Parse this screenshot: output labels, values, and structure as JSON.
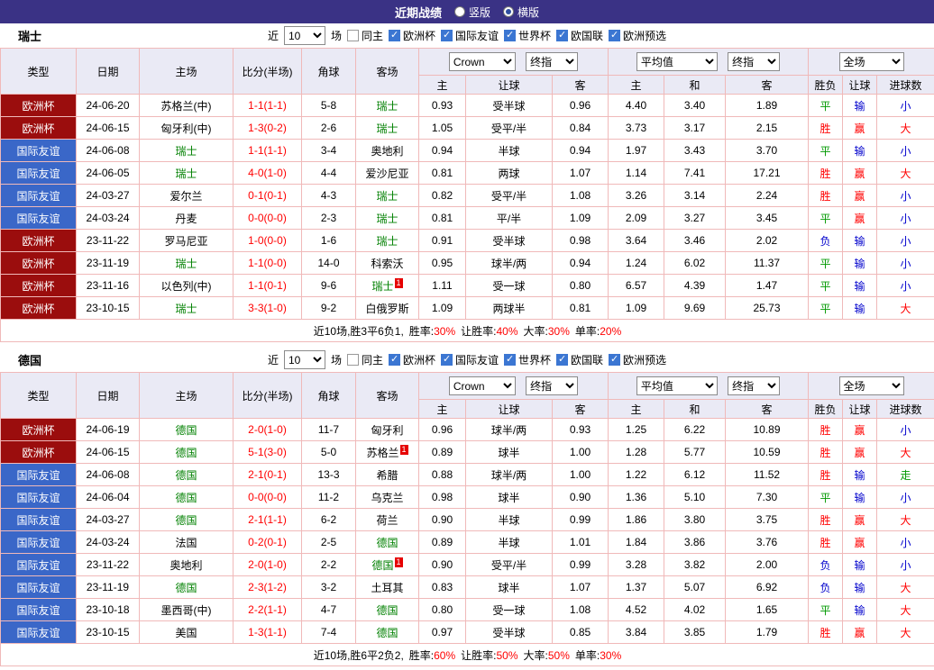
{
  "colors": {
    "topbar_bg": "#3A3285",
    "header_bg": "#EAEAF5",
    "border": "#F0B9B9",
    "cup_bg": "#9B0D0D",
    "friendly_bg": "#3A67C8",
    "focus": "#008000",
    "score": "#FF0000",
    "red": "#FF0000",
    "green": "#009900",
    "blue": "#0000CC"
  },
  "result_color_map": {
    "胜": "r",
    "平": "g",
    "负": "b",
    "赢": "r",
    "输": "b",
    "大": "r",
    "小": "b",
    "走": "g"
  },
  "topbar": {
    "title": "近期战绩",
    "radios": [
      {
        "label": "竖版",
        "selected": false
      },
      {
        "label": "横版",
        "selected": true
      }
    ]
  },
  "sections": [
    {
      "team": "瑞士",
      "filter": {
        "near": "近",
        "count": "10",
        "unit": "场",
        "checkboxes": [
          {
            "label": "同主",
            "checked": false
          },
          {
            "label": "欧洲杯",
            "checked": true
          },
          {
            "label": "国际友谊",
            "checked": true
          },
          {
            "label": "世界杯",
            "checked": true
          },
          {
            "label": "欧国联",
            "checked": true
          },
          {
            "label": "欧洲预选",
            "checked": true
          }
        ]
      },
      "table": {
        "col_headers": [
          "类型",
          "日期",
          "主场",
          "比分(半场)",
          "角球",
          "客场"
        ],
        "odds_selects": [
          "Crown",
          "终指"
        ],
        "avg_selects": [
          "平均值",
          "终指"
        ],
        "scope_select": "全场",
        "sub_headers": [
          "主",
          "让球",
          "客",
          "主",
          "和",
          "客",
          "胜负",
          "让球",
          "进球数"
        ],
        "rows": [
          {
            "type": "欧洲杯",
            "style": "cup",
            "date": "24-06-20",
            "home": "苏格兰(中)",
            "home_focus": false,
            "home_card": "",
            "score": "1-1(1-1)",
            "corners": "5-8",
            "away": "瑞士",
            "away_focus": true,
            "away_card": "",
            "odds": [
              "0.93",
              "受半球",
              "0.96"
            ],
            "avg": [
              "4.40",
              "3.40",
              "1.89"
            ],
            "results": [
              "平",
              "输",
              "小"
            ]
          },
          {
            "type": "欧洲杯",
            "style": "cup",
            "date": "24-06-15",
            "home": "匈牙利(中)",
            "home_focus": false,
            "home_card": "",
            "score": "1-3(0-2)",
            "corners": "2-6",
            "away": "瑞士",
            "away_focus": true,
            "away_card": "",
            "odds": [
              "1.05",
              "受平/半",
              "0.84"
            ],
            "avg": [
              "3.73",
              "3.17",
              "2.15"
            ],
            "results": [
              "胜",
              "赢",
              "大"
            ]
          },
          {
            "type": "国际友谊",
            "style": "friendly",
            "date": "24-06-08",
            "home": "瑞士",
            "home_focus": true,
            "home_card": "",
            "score": "1-1(1-1)",
            "corners": "3-4",
            "away": "奥地利",
            "away_focus": false,
            "away_card": "",
            "odds": [
              "0.94",
              "半球",
              "0.94"
            ],
            "avg": [
              "1.97",
              "3.43",
              "3.70"
            ],
            "results": [
              "平",
              "输",
              "小"
            ]
          },
          {
            "type": "国际友谊",
            "style": "friendly",
            "date": "24-06-05",
            "home": "瑞士",
            "home_focus": true,
            "home_card": "",
            "score": "4-0(1-0)",
            "corners": "4-4",
            "away": "爱沙尼亚",
            "away_focus": false,
            "away_card": "",
            "odds": [
              "0.81",
              "两球",
              "1.07"
            ],
            "avg": [
              "1.14",
              "7.41",
              "17.21"
            ],
            "results": [
              "胜",
              "赢",
              "大"
            ]
          },
          {
            "type": "国际友谊",
            "style": "friendly",
            "date": "24-03-27",
            "home": "爱尔兰",
            "home_focus": false,
            "home_card": "",
            "score": "0-1(0-1)",
            "corners": "4-3",
            "away": "瑞士",
            "away_focus": true,
            "away_card": "",
            "odds": [
              "0.82",
              "受平/半",
              "1.08"
            ],
            "avg": [
              "3.26",
              "3.14",
              "2.24"
            ],
            "results": [
              "胜",
              "赢",
              "小"
            ]
          },
          {
            "type": "国际友谊",
            "style": "friendly",
            "date": "24-03-24",
            "home": "丹麦",
            "home_focus": false,
            "home_card": "",
            "score": "0-0(0-0)",
            "corners": "2-3",
            "away": "瑞士",
            "away_focus": true,
            "away_card": "",
            "odds": [
              "0.81",
              "平/半",
              "1.09"
            ],
            "avg": [
              "2.09",
              "3.27",
              "3.45"
            ],
            "results": [
              "平",
              "赢",
              "小"
            ]
          },
          {
            "type": "欧洲杯",
            "style": "cup",
            "date": "23-11-22",
            "home": "罗马尼亚",
            "home_focus": false,
            "home_card": "",
            "score": "1-0(0-0)",
            "corners": "1-6",
            "away": "瑞士",
            "away_focus": true,
            "away_card": "",
            "odds": [
              "0.91",
              "受半球",
              "0.98"
            ],
            "avg": [
              "3.64",
              "3.46",
              "2.02"
            ],
            "results": [
              "负",
              "输",
              "小"
            ]
          },
          {
            "type": "欧洲杯",
            "style": "cup",
            "date": "23-11-19",
            "home": "瑞士",
            "home_focus": true,
            "home_card": "",
            "score": "1-1(0-0)",
            "corners": "14-0",
            "away": "科索沃",
            "away_focus": false,
            "away_card": "",
            "odds": [
              "0.95",
              "球半/两",
              "0.94"
            ],
            "avg": [
              "1.24",
              "6.02",
              "11.37"
            ],
            "results": [
              "平",
              "输",
              "小"
            ]
          },
          {
            "type": "欧洲杯",
            "style": "cup",
            "date": "23-11-16",
            "home": "以色列(中)",
            "home_focus": false,
            "home_card": "",
            "score": "1-1(0-1)",
            "corners": "9-6",
            "away": "瑞士",
            "away_focus": true,
            "away_card": "1",
            "odds": [
              "1.11",
              "受一球",
              "0.80"
            ],
            "avg": [
              "6.57",
              "4.39",
              "1.47"
            ],
            "results": [
              "平",
              "输",
              "小"
            ]
          },
          {
            "type": "欧洲杯",
            "style": "cup",
            "date": "23-10-15",
            "home": "瑞士",
            "home_focus": true,
            "home_card": "",
            "score": "3-3(1-0)",
            "corners": "9-2",
            "away": "白俄罗斯",
            "away_focus": false,
            "away_card": "",
            "odds": [
              "1.09",
              "两球半",
              "0.81"
            ],
            "avg": [
              "1.09",
              "9.69",
              "25.73"
            ],
            "results": [
              "平",
              "输",
              "大"
            ]
          }
        ]
      },
      "summary": {
        "prefix": "近10场,胜3平6负1,",
        "stats": [
          {
            "label": "胜率:",
            "value": "30%"
          },
          {
            "label": "让胜率:",
            "value": "40%"
          },
          {
            "label": "大率:",
            "value": "30%"
          },
          {
            "label": "单率:",
            "value": "20%"
          }
        ]
      }
    },
    {
      "team": "德国",
      "filter": {
        "near": "近",
        "count": "10",
        "unit": "场",
        "checkboxes": [
          {
            "label": "同主",
            "checked": false
          },
          {
            "label": "欧洲杯",
            "checked": true
          },
          {
            "label": "国际友谊",
            "checked": true
          },
          {
            "label": "世界杯",
            "checked": true
          },
          {
            "label": "欧国联",
            "checked": true
          },
          {
            "label": "欧洲预选",
            "checked": true
          }
        ]
      },
      "table": {
        "col_headers": [
          "类型",
          "日期",
          "主场",
          "比分(半场)",
          "角球",
          "客场"
        ],
        "odds_selects": [
          "Crown",
          "终指"
        ],
        "avg_selects": [
          "平均值",
          "终指"
        ],
        "scope_select": "全场",
        "sub_headers": [
          "主",
          "让球",
          "客",
          "主",
          "和",
          "客",
          "胜负",
          "让球",
          "进球数"
        ],
        "rows": [
          {
            "type": "欧洲杯",
            "style": "cup",
            "date": "24-06-19",
            "home": "德国",
            "home_focus": true,
            "home_card": "",
            "score": "2-0(1-0)",
            "corners": "11-7",
            "away": "匈牙利",
            "away_focus": false,
            "away_card": "",
            "odds": [
              "0.96",
              "球半/两",
              "0.93"
            ],
            "avg": [
              "1.25",
              "6.22",
              "10.89"
            ],
            "results": [
              "胜",
              "赢",
              "小"
            ]
          },
          {
            "type": "欧洲杯",
            "style": "cup",
            "date": "24-06-15",
            "home": "德国",
            "home_focus": true,
            "home_card": "",
            "score": "5-1(3-0)",
            "corners": "5-0",
            "away": "苏格兰",
            "away_focus": false,
            "away_card": "1",
            "odds": [
              "0.89",
              "球半",
              "1.00"
            ],
            "avg": [
              "1.28",
              "5.77",
              "10.59"
            ],
            "results": [
              "胜",
              "赢",
              "大"
            ]
          },
          {
            "type": "国际友谊",
            "style": "friendly",
            "date": "24-06-08",
            "home": "德国",
            "home_focus": true,
            "home_card": "",
            "score": "2-1(0-1)",
            "corners": "13-3",
            "away": "希腊",
            "away_focus": false,
            "away_card": "",
            "odds": [
              "0.88",
              "球半/两",
              "1.00"
            ],
            "avg": [
              "1.22",
              "6.12",
              "11.52"
            ],
            "results": [
              "胜",
              "输",
              "走"
            ]
          },
          {
            "type": "国际友谊",
            "style": "friendly",
            "date": "24-06-04",
            "home": "德国",
            "home_focus": true,
            "home_card": "",
            "score": "0-0(0-0)",
            "corners": "11-2",
            "away": "乌克兰",
            "away_focus": false,
            "away_card": "",
            "odds": [
              "0.98",
              "球半",
              "0.90"
            ],
            "avg": [
              "1.36",
              "5.10",
              "7.30"
            ],
            "results": [
              "平",
              "输",
              "小"
            ]
          },
          {
            "type": "国际友谊",
            "style": "friendly",
            "date": "24-03-27",
            "home": "德国",
            "home_focus": true,
            "home_card": "",
            "score": "2-1(1-1)",
            "corners": "6-2",
            "away": "荷兰",
            "away_focus": false,
            "away_card": "",
            "odds": [
              "0.90",
              "半球",
              "0.99"
            ],
            "avg": [
              "1.86",
              "3.80",
              "3.75"
            ],
            "results": [
              "胜",
              "赢",
              "大"
            ]
          },
          {
            "type": "国际友谊",
            "style": "friendly",
            "date": "24-03-24",
            "home": "法国",
            "home_focus": false,
            "home_card": "",
            "score": "0-2(0-1)",
            "corners": "2-5",
            "away": "德国",
            "away_focus": true,
            "away_card": "",
            "odds": [
              "0.89",
              "半球",
              "1.01"
            ],
            "avg": [
              "1.84",
              "3.86",
              "3.76"
            ],
            "results": [
              "胜",
              "赢",
              "小"
            ]
          },
          {
            "type": "国际友谊",
            "style": "friendly",
            "date": "23-11-22",
            "home": "奥地利",
            "home_focus": false,
            "home_card": "",
            "score": "2-0(1-0)",
            "corners": "2-2",
            "away": "德国",
            "away_focus": true,
            "away_card": "1",
            "odds": [
              "0.90",
              "受平/半",
              "0.99"
            ],
            "avg": [
              "3.28",
              "3.82",
              "2.00"
            ],
            "results": [
              "负",
              "输",
              "小"
            ]
          },
          {
            "type": "国际友谊",
            "style": "friendly",
            "date": "23-11-19",
            "home": "德国",
            "home_focus": true,
            "home_card": "",
            "score": "2-3(1-2)",
            "corners": "3-2",
            "away": "土耳其",
            "away_focus": false,
            "away_card": "",
            "odds": [
              "0.83",
              "球半",
              "1.07"
            ],
            "avg": [
              "1.37",
              "5.07",
              "6.92"
            ],
            "results": [
              "负",
              "输",
              "大"
            ]
          },
          {
            "type": "国际友谊",
            "style": "friendly",
            "date": "23-10-18",
            "home": "墨西哥(中)",
            "home_focus": false,
            "home_card": "",
            "score": "2-2(1-1)",
            "corners": "4-7",
            "away": "德国",
            "away_focus": true,
            "away_card": "",
            "odds": [
              "0.80",
              "受一球",
              "1.08"
            ],
            "avg": [
              "4.52",
              "4.02",
              "1.65"
            ],
            "results": [
              "平",
              "输",
              "大"
            ]
          },
          {
            "type": "国际友谊",
            "style": "friendly",
            "date": "23-10-15",
            "home": "美国",
            "home_focus": false,
            "home_card": "",
            "score": "1-3(1-1)",
            "corners": "7-4",
            "away": "德国",
            "away_focus": true,
            "away_card": "",
            "odds": [
              "0.97",
              "受半球",
              "0.85"
            ],
            "avg": [
              "3.84",
              "3.85",
              "1.79"
            ],
            "results": [
              "胜",
              "赢",
              "大"
            ]
          }
        ]
      },
      "summary": {
        "prefix": "近10场,胜6平2负2,",
        "stats": [
          {
            "label": "胜率:",
            "value": "60%"
          },
          {
            "label": "让胜率:",
            "value": "50%"
          },
          {
            "label": "大率:",
            "value": "50%"
          },
          {
            "label": "单率:",
            "value": "30%"
          }
        ]
      }
    }
  ]
}
